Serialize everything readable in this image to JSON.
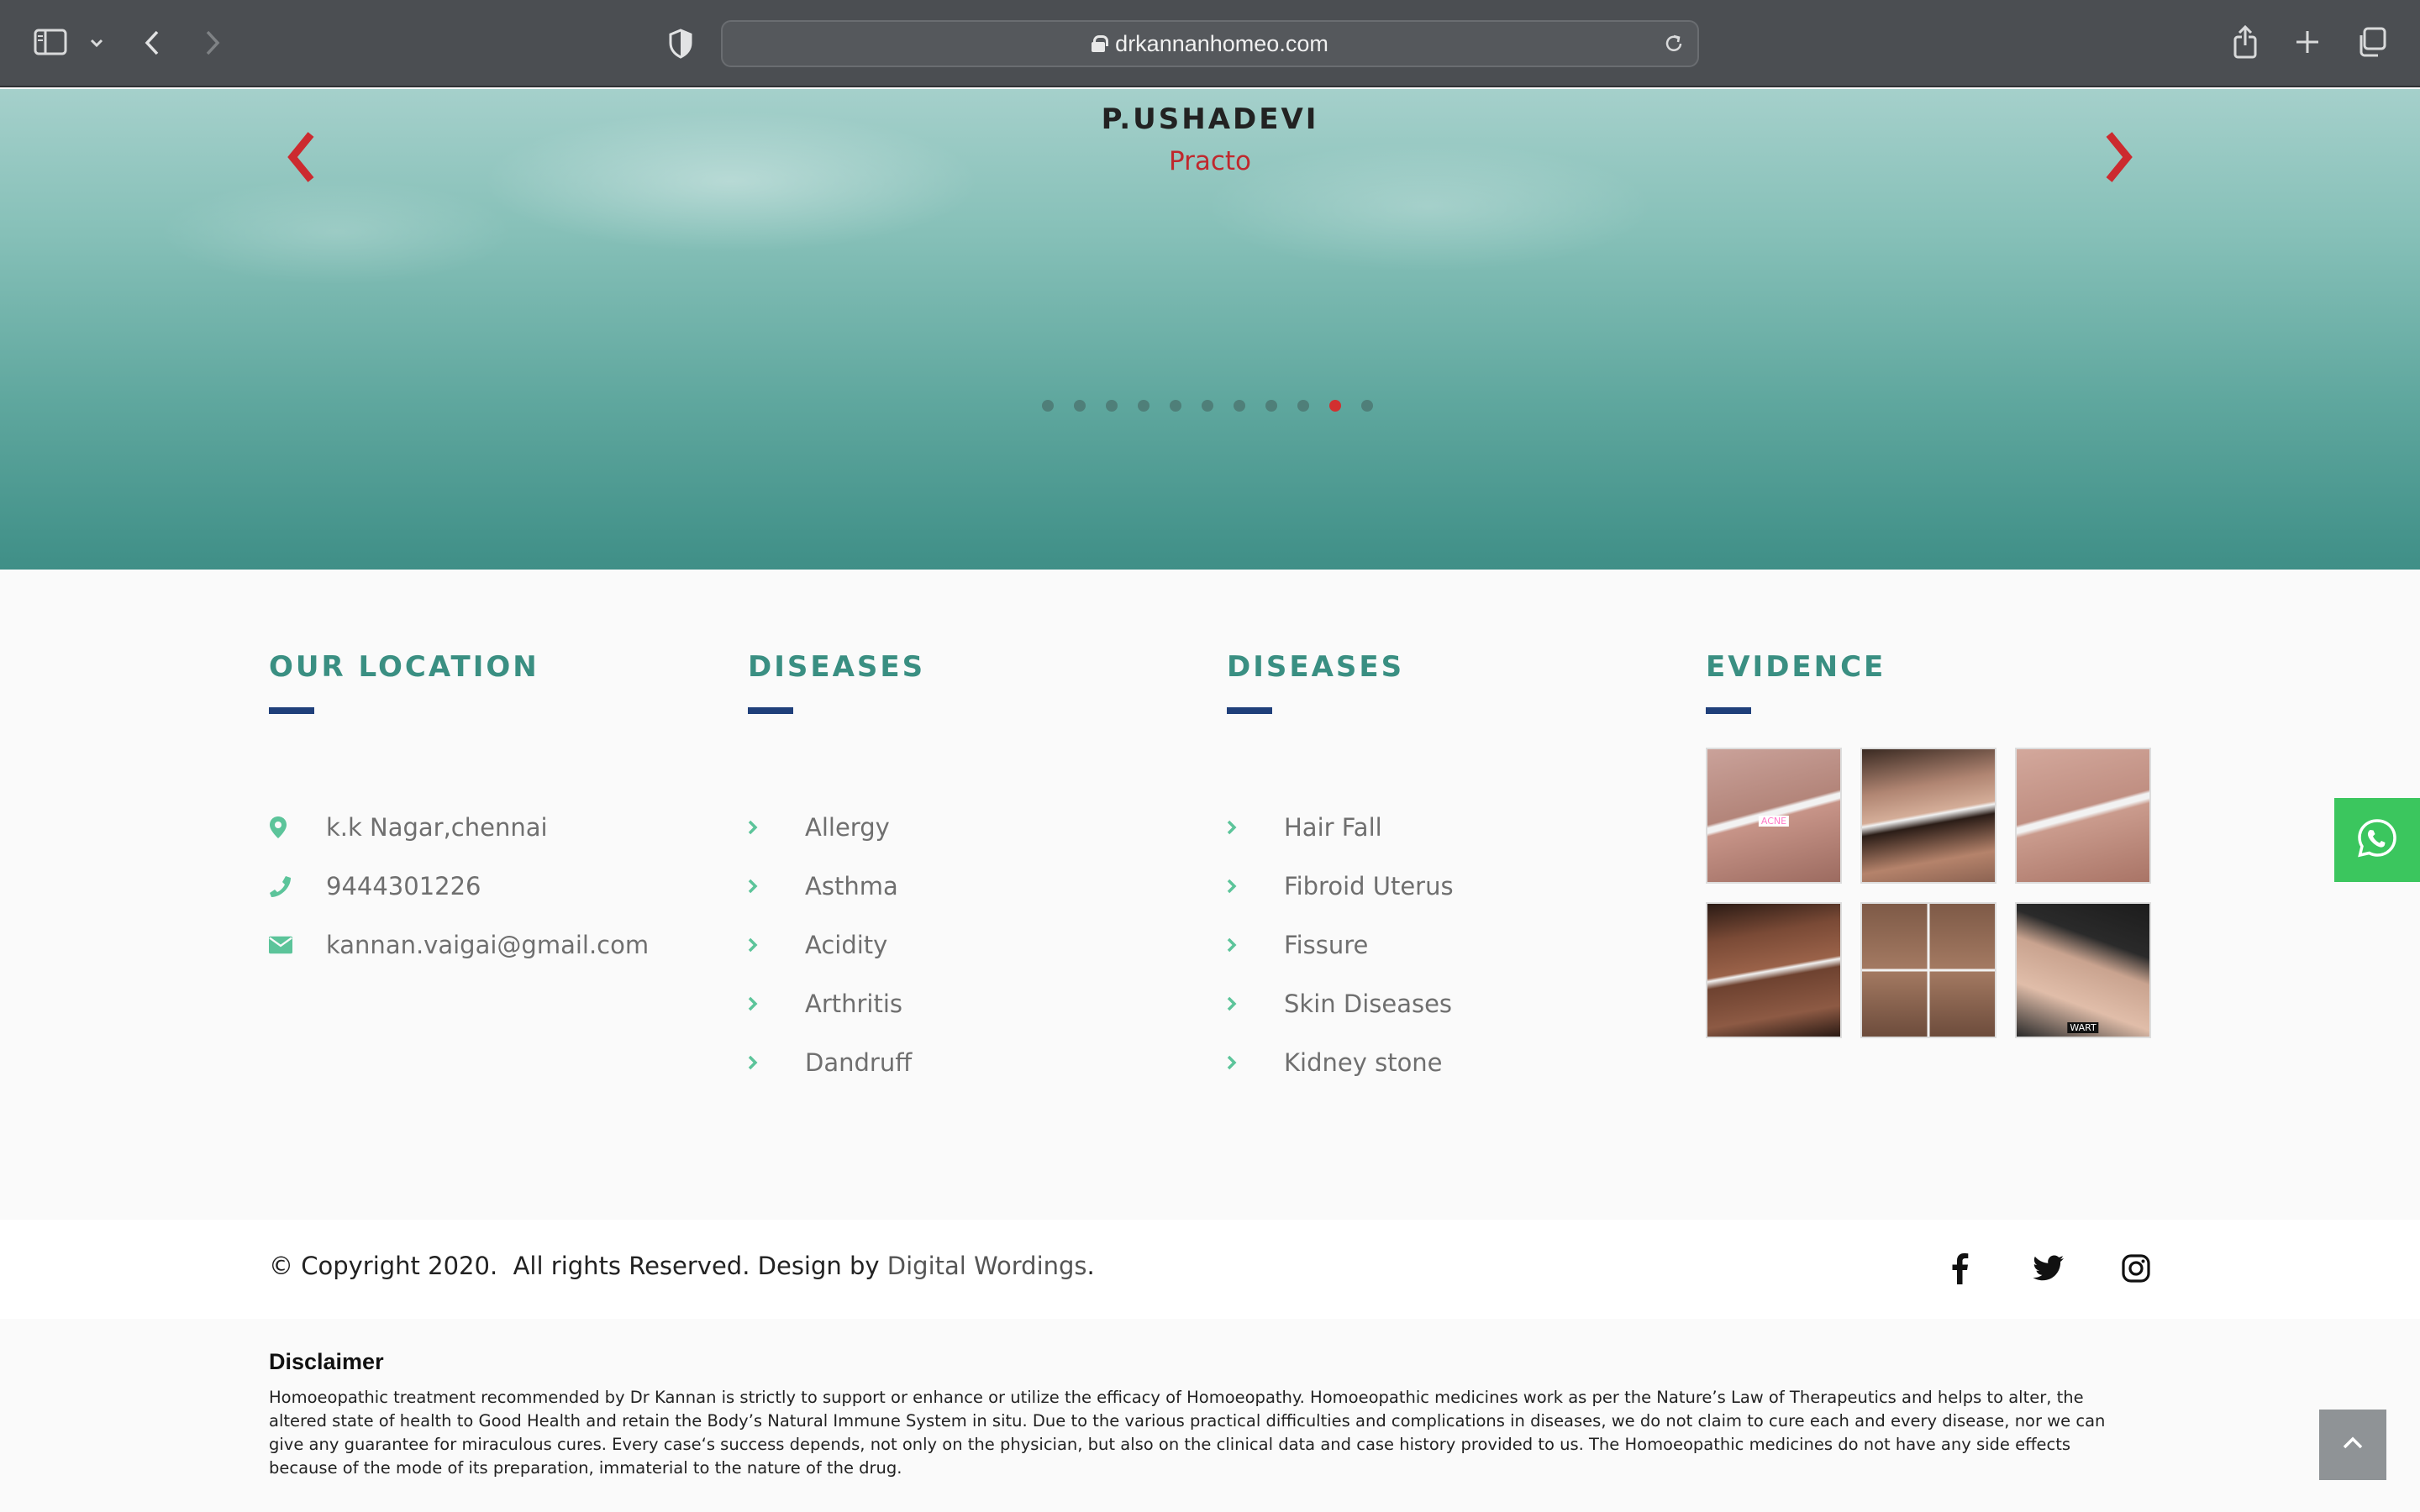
{
  "browser": {
    "url": "drkannanhomeo.com"
  },
  "testimonial": {
    "name": "P.USHADEVI",
    "source": "Practo",
    "dot_count": 11,
    "active_dot": 9
  },
  "columns": {
    "location": {
      "title": "OUR LOCATION",
      "address": "k.k Nagar,chennai",
      "phone": "9444301226",
      "email": "kannan.vaigai@gmail.com"
    },
    "diseases_1": {
      "title": "DISEASES",
      "items": [
        "Allergy",
        "Asthma",
        "Acidity",
        "Arthritis",
        "Dandruff"
      ]
    },
    "diseases_2": {
      "title": "DISEASES",
      "items": [
        "Hair Fall",
        "Fibroid Uterus",
        "Fissure",
        "Skin Diseases",
        "Kidney stone"
      ]
    },
    "evidence": {
      "title": "EVIDENCE",
      "tags": [
        "ACNE",
        "",
        "",
        "",
        "",
        "WART"
      ]
    }
  },
  "footer": {
    "copyright_prefix": "© Copyright 2020.  All rights Reserved. Design by ",
    "designer": "Digital Wordings",
    "suffix": "."
  },
  "disclaimer": {
    "title": "Disclaimer",
    "text": "Homoeopathic treatment recommended by Dr Kannan is strictly to support or enhance or utilize the efficacy of Homoeopathy. Homoeopathic medicines work as per the Nature’s Law of Therapeutics and helps to alter, the altered state of health to Good Health and retain the Body’s Natural Immune System in situ. Due to the various practical difficulties and complications in diseases, we do not claim to cure each and every disease, nor we can give any guarantee for miraculous cures. Every case‘s success depends, not only on the physician, but also on the clinical data and case history provided to us. The Homoeopathic medicines do not have any side effects because of the mode of its preparation, immaterial to the nature of the drug."
  },
  "colors": {
    "accent_teal": "#3a8f82",
    "accent_navy": "#1f3f7a",
    "accent_red": "#c0282d",
    "whatsapp_green": "#3bc65e"
  }
}
